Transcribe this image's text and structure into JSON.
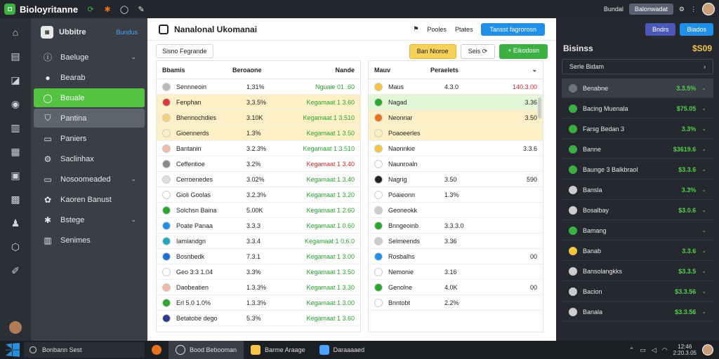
{
  "topbar": {
    "app_name": "Bioloyritanne",
    "right_label": "Bundal",
    "pill_label": "Balonwadat"
  },
  "sidebar": {
    "title": "Ubbitre",
    "link": "Bundus",
    "items": [
      {
        "label": "Baeluge",
        "chevron": true
      },
      {
        "label": "Bearab",
        "chevron": false
      },
      {
        "label": "Beuale",
        "chevron": false
      },
      {
        "label": "Pantina",
        "chevron": false
      },
      {
        "label": "Paniers",
        "chevron": false
      },
      {
        "label": "Saclinhax",
        "chevron": false
      },
      {
        "label": "Nosoomeaded",
        "chevron": true
      },
      {
        "label": "Kaoren Banust",
        "chevron": false
      },
      {
        "label": "Bstege",
        "chevron": true
      },
      {
        "label": "Senimes",
        "chevron": false
      }
    ]
  },
  "main": {
    "title": "Nanalonal Ukomanai",
    "head_label_1": "Pooles",
    "head_label_2": "Ptates",
    "head_button": "Tansst fagrorosn",
    "filter_tab": "Sisno Fegrande",
    "btn_yellow": "Ban Nioroe",
    "btn_white": "Seis",
    "btn_green": "Eikodosn",
    "left_headers": [
      "Bbamis",
      "Beroaone",
      "Nande"
    ],
    "left_rows": [
      {
        "name": "Sennneoin",
        "v1": "1,31%",
        "v2": "Nguaie  01 .60",
        "color": "#bbb",
        "hl": "",
        "red": false
      },
      {
        "name": "Fenphan",
        "v1": "3,3.5%",
        "v2": "Kegamaat 1 3.60",
        "color": "#d93a3a",
        "hl": "y",
        "red": false
      },
      {
        "name": "Bhennochdies",
        "v1": "3.10K",
        "v2": "Kegamaat 1 3.510",
        "color": "#f4d27a",
        "hl": "y",
        "red": false
      },
      {
        "name": "Gioennerds",
        "v1": "1.3%",
        "v2": "Kegamaat 1 3.50",
        "color": "#fdefc6",
        "hl": "y",
        "red": false
      },
      {
        "name": "Bantanin",
        "v1": "3.2.3%",
        "v2": "Kegamaat 1 3.510",
        "color": "#f2b9a8",
        "hl": "",
        "red": false
      },
      {
        "name": "Ceffentioe",
        "v1": "3.2%",
        "v2": "Kegamaat 1 3.40",
        "color": "#888",
        "hl": "",
        "red": true
      },
      {
        "name": "Cerroenedes",
        "v1": "3.02%",
        "v2": "Kegamaat 1 3.40",
        "color": "#ddd",
        "hl": "",
        "red": false
      },
      {
        "name": "Gioli Goolas",
        "v1": "3.2.3%",
        "v2": "Kegamaat 1 3.20",
        "color": "#fff",
        "hl": "",
        "red": false
      },
      {
        "name": "Solchsn Baina",
        "v1": "5.00K",
        "v2": "Kegamaat 1 2.60",
        "color": "#2aa52e",
        "hl": "",
        "red": false
      },
      {
        "name": "Poate Panaa",
        "v1": "3.3.3",
        "v2": "Kegamaat 1 0.60",
        "color": "#1f8fe8",
        "hl": "",
        "red": false
      },
      {
        "name": "Iamlandgn",
        "v1": "3.3.4",
        "v2": "Kegamaat 1 0.6.0",
        "color": "#1fa8c0",
        "hl": "",
        "red": false
      },
      {
        "name": "Bosnbedk",
        "v1": "7.3.1",
        "v2": "Kegamaat 1 3.00",
        "color": "#1f6fd8",
        "hl": "",
        "red": false
      },
      {
        "name": "Geo 3:3 1.04",
        "v1": "3.3%",
        "v2": "Kegamaat 1 3.50",
        "color": "#fff",
        "hl": "",
        "red": false
      },
      {
        "name": "Daobeatien",
        "v1": "1.3.3%",
        "v2": "Kegamaat 1 3.30",
        "color": "#f2b9a8",
        "hl": "",
        "red": false
      },
      {
        "name": "Erl 5.0 1.0%",
        "v1": "1.3.3%",
        "v2": "Kegamaat 1 3.00",
        "color": "#2aa52e",
        "hl": "",
        "red": false
      },
      {
        "name": "Betatobe dego",
        "v1": "5.3%",
        "v2": "Kegamaat 1 3.60",
        "color": "#2b3a8c",
        "hl": "",
        "red": false
      }
    ],
    "right_headers": [
      "Mauv",
      "Peraelets",
      ""
    ],
    "right_rows": [
      {
        "name": "Maus",
        "v1": "4.3.0",
        "v2": "140.3.00",
        "color": "#f4c542",
        "hl": "",
        "red": true
      },
      {
        "name": "Nagad",
        "v1": "",
        "v2": "3.36",
        "color": "#2aa52e",
        "hl": "g",
        "red": false
      },
      {
        "name": "Neonnar",
        "v1": "",
        "v2": "3.50",
        "color": "#e8731f",
        "hl": "y",
        "red": false
      },
      {
        "name": "Poaoeerles",
        "v1": "",
        "v2": "",
        "color": "#fdefc6",
        "hl": "y",
        "red": false
      },
      {
        "name": "Naonnkie",
        "v1": "",
        "v2": "3.3.6",
        "color": "#f4c542",
        "hl": "",
        "red": false
      },
      {
        "name": "Naunroaln",
        "v1": "",
        "v2": "",
        "color": "#fff",
        "hl": "",
        "red": false
      },
      {
        "name": "Nagrig",
        "v1": "3.50",
        "v2": "590",
        "color": "#222",
        "hl": "",
        "red": false
      },
      {
        "name": "Poaieonn",
        "v1": "1.3%",
        "v2": "",
        "color": "#fff",
        "hl": "",
        "red": true
      },
      {
        "name": "Geoneokk",
        "v1": "",
        "v2": "",
        "color": "#ccc",
        "hl": "",
        "red": false
      },
      {
        "name": "Bnngeoinb",
        "v1": "3.3.3.0",
        "v2": "",
        "color": "#2aa52e",
        "hl": "",
        "red": false
      },
      {
        "name": "Selmeends",
        "v1": "3.36",
        "v2": "",
        "color": "#ccc",
        "hl": "",
        "red": false
      },
      {
        "name": "Rosbalhs",
        "v1": "",
        "v2": "00",
        "color": "#1f8fe8",
        "hl": "",
        "red": false
      },
      {
        "name": "Nemonie",
        "v1": "3.16",
        "v2": "",
        "color": "#fff",
        "hl": "",
        "red": true
      },
      {
        "name": "Genolne",
        "v1": "4.0K",
        "v2": "00",
        "color": "#2aa52e",
        "hl": "",
        "red": false
      },
      {
        "name": "Bnntobt",
        "v1": "2.2%",
        "v2": "",
        "color": "#fff",
        "hl": "",
        "red": false
      }
    ]
  },
  "right_panel": {
    "btn_indigo": "Bndrs",
    "btn_sky": "Biados",
    "title": "Bisinss",
    "amount": "$S09",
    "select_label": "Serle Bidam",
    "rows": [
      {
        "name": "Benabne",
        "value": "3.3.5%",
        "color": "#6b7280"
      },
      {
        "name": "Bacing Muenala",
        "value": "$75.05",
        "color": "#3cb043"
      },
      {
        "name": "Farsg Bedan 3",
        "value": "3.3%",
        "color": "#3cb043"
      },
      {
        "name": "Banne",
        "value": "$3619.6",
        "color": "#3cb043"
      },
      {
        "name": "Baunge 3 Balkbraol",
        "value": "$3.3.6",
        "color": "#3cb043"
      },
      {
        "name": "Bansla",
        "value": "3.3%",
        "color": "#ccc"
      },
      {
        "name": "Bosalbay",
        "value": "$3.0.6",
        "color": "#ccc"
      },
      {
        "name": "Bamang",
        "value": "",
        "color": "#3cb043"
      },
      {
        "name": "Banab",
        "value": "3.3.6",
        "color": "#f4c542"
      },
      {
        "name": "Bansolangkks",
        "value": "$3.3.5",
        "color": "#ccc"
      },
      {
        "name": "Bacion",
        "value": "$3.3.56",
        "color": "#ccc"
      },
      {
        "name": "Banala",
        "value": "$3.3.56",
        "color": "#ccc"
      }
    ]
  },
  "taskbar": {
    "search": "Bonbann Sest",
    "tasks": [
      "Bood Bebooman",
      "Barme Araage",
      "Daraaaaed"
    ],
    "time": "12:46",
    "date": "2:20.3.05"
  }
}
